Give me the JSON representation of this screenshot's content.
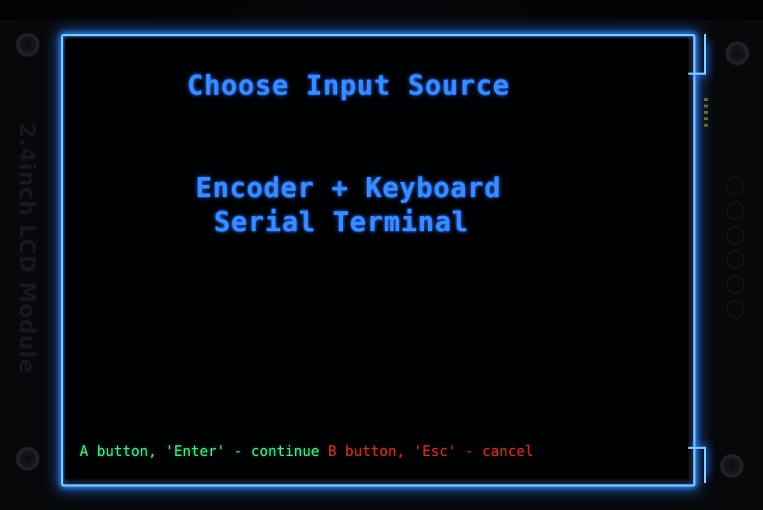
{
  "device": {
    "side_label": "2.4inch LCD Module"
  },
  "screen": {
    "title": "Choose Input Source",
    "options": [
      {
        "label": "Encoder + Keyboard",
        "selected": true
      },
      {
        "label": "Serial Terminal",
        "selected": false
      }
    ],
    "hint_continue": "A button, 'Enter' - continue",
    "hint_cancel": "B button, 'Esc' - cancel"
  },
  "colors": {
    "text_primary": "#3a8bff",
    "hint_continue": "#4fe08a",
    "hint_cancel": "#b8352d",
    "backlight_glow": "#7fc4ff"
  }
}
